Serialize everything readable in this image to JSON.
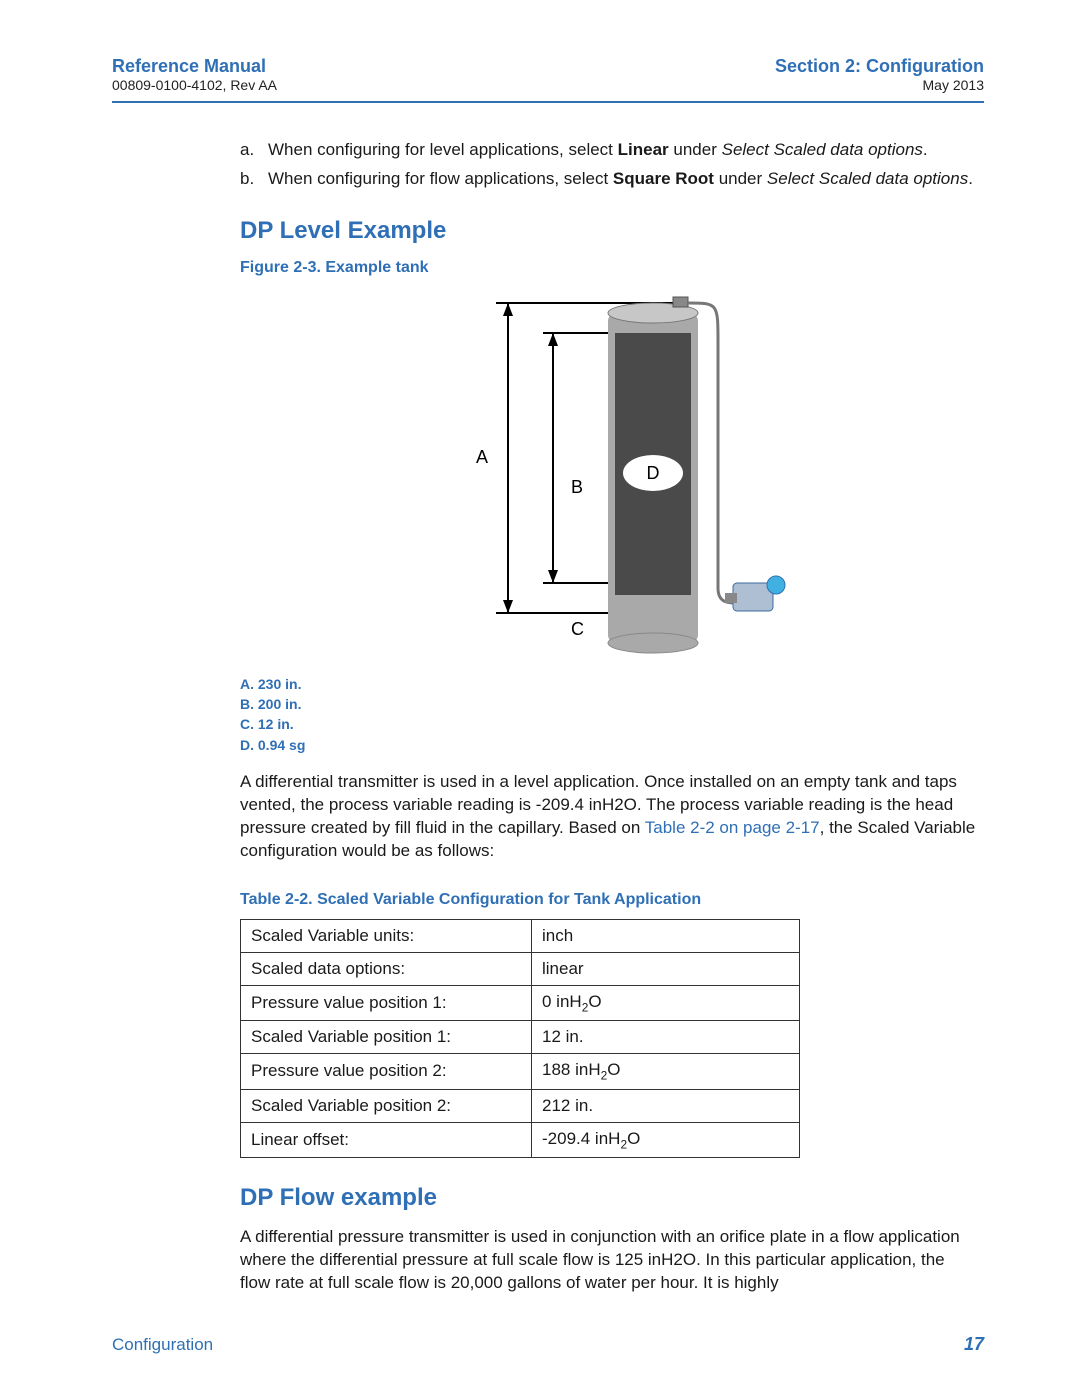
{
  "header": {
    "left_title": "Reference Manual",
    "left_sub": "00809-0100-4102, Rev AA",
    "right_title": "Section 2: Configuration",
    "right_sub": "May 2013"
  },
  "list": {
    "a_marker": "a.",
    "a_pre": "When configuring for level applications, select ",
    "a_bold": "Linear",
    "a_mid": " under ",
    "a_ital": "Select Scaled data options",
    "a_post": ".",
    "b_marker": "b.",
    "b_pre": "When configuring for flow applications, select ",
    "b_bold": "Square Root",
    "b_mid": " under ",
    "b_ital": "Select Scaled data options",
    "b_post": "."
  },
  "section1_heading": "DP Level Example",
  "figure_caption": "Figure 2-3. Example tank",
  "fig_labels": {
    "A": "A",
    "B": "B",
    "C": "C",
    "D": "D"
  },
  "legend": {
    "a": "A. 230 in.",
    "b": "B. 200 in.",
    "c": "C. 12 in.",
    "d": "D. 0.94 sg"
  },
  "para1_pre": "A differential transmitter is used in a level application. Once installed on an empty tank and taps vented, the process variable reading is -209.4 inH2O. The process variable reading is the head pressure created by fill fluid in the capillary. Based on ",
  "para1_link": "Table 2-2 on page 2-17",
  "para1_post": ", the Scaled Variable configuration would be as follows:",
  "table_caption": "Table 2-2.  Scaled Variable Configuration for Tank Application",
  "table": {
    "r1k": "Scaled Variable units:",
    "r1v": "inch",
    "r2k": "Scaled data options:",
    "r2v": "linear",
    "r3k": "Pressure value position 1:",
    "r3v_pre": "0 inH",
    "r3v_sub": "2",
    "r3v_post": "O",
    "r4k": "Scaled Variable position 1:",
    "r4v": "12 in.",
    "r5k": "Pressure value position 2:",
    "r5v_pre": "188 inH",
    "r5v_sub": "2",
    "r5v_post": "O",
    "r6k": "Scaled Variable position 2:",
    "r6v": "212 in.",
    "r7k": "Linear offset:",
    "r7v_pre": "-209.4 inH",
    "r7v_sub": "2",
    "r7v_post": "O"
  },
  "section2_heading": "DP Flow example",
  "para2": "A differential pressure transmitter is used in conjunction with an orifice plate in a flow application where the differential pressure at full scale flow is 125 inH2O. In this particular application, the flow rate at full scale flow is 20,000 gallons of water per hour. It is highly",
  "footer_left": "Configuration",
  "footer_right": "17"
}
